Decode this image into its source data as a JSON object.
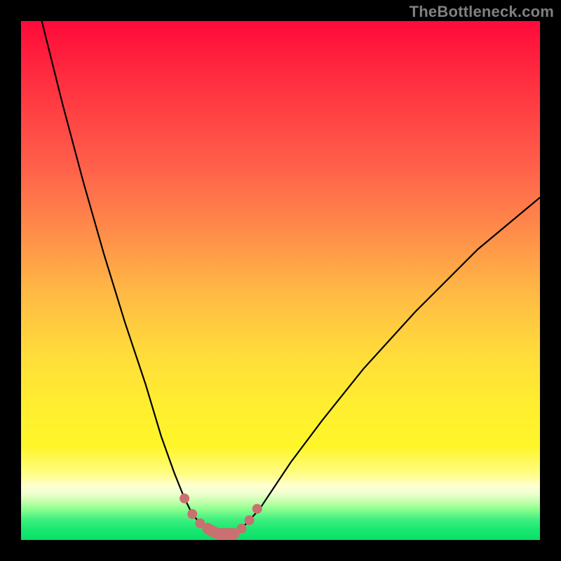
{
  "watermark": "TheBottleneck.com",
  "chart_data": {
    "type": "line",
    "title": "",
    "xlabel": "",
    "ylabel": "",
    "xlim": [
      0,
      100
    ],
    "ylim": [
      0,
      100
    ],
    "series": [
      {
        "name": "left-curve",
        "x": [
          4,
          8,
          12,
          16,
          20,
          24,
          27,
          29.5,
          31.5,
          33,
          34.5,
          36,
          37,
          38
        ],
        "values": [
          100,
          84,
          69,
          55,
          42,
          30,
          20,
          13,
          8,
          5,
          3.2,
          2.2,
          1.6,
          1.2
        ]
      },
      {
        "name": "right-curve",
        "x": [
          41,
          42.5,
          44,
          46,
          48,
          52,
          58,
          66,
          76,
          88,
          100
        ],
        "values": [
          1.2,
          2.2,
          3.8,
          6,
          9,
          15,
          23,
          33,
          44,
          56,
          66
        ]
      },
      {
        "name": "dotted-salmon",
        "x": [
          31.5,
          33,
          34.5,
          36,
          37,
          38,
          39.5,
          41,
          42.5,
          44,
          45.5
        ],
        "values": [
          8,
          5,
          3.2,
          2.2,
          1.6,
          1.2,
          1.2,
          1.2,
          2.2,
          3.8,
          6
        ]
      }
    ],
    "grid": false,
    "legend": false,
    "axes_visible": false,
    "background_gradient": {
      "stops": [
        {
          "pos": 0.0,
          "color": "#ff0a3c"
        },
        {
          "pos": 0.28,
          "color": "#ff604a"
        },
        {
          "pos": 0.52,
          "color": "#ffb845"
        },
        {
          "pos": 0.74,
          "color": "#ffee30"
        },
        {
          "pos": 0.9,
          "color": "#ffffd0"
        },
        {
          "pos": 0.94,
          "color": "#90ff90"
        },
        {
          "pos": 1.0,
          "color": "#0ae068"
        }
      ]
    },
    "colors": {
      "curve": "#000000",
      "dotted": "#c97070",
      "frame": "#000000"
    }
  }
}
